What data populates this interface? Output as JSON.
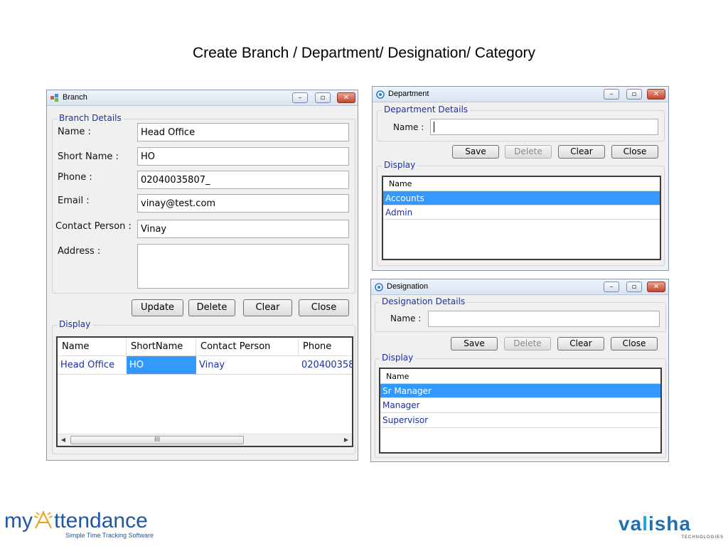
{
  "slide": {
    "title": "Create Branch / Department/ Designation/ Category"
  },
  "branch": {
    "window_title": "Branch",
    "group_details": "Branch Details",
    "fields": {
      "name": {
        "label": "Name :",
        "value": "Head Office"
      },
      "short_name": {
        "label": "Short Name :",
        "value": "HO"
      },
      "phone": {
        "label": "Phone :",
        "value": "02040035807_"
      },
      "email": {
        "label": "Email :",
        "value": "vinay@test.com"
      },
      "contact_person": {
        "label": "Contact Person :",
        "value": "Vinay"
      },
      "address": {
        "label": "Address :",
        "value": ""
      }
    },
    "buttons": {
      "update": "Update",
      "delete": "Delete",
      "clear": "Clear",
      "close": "Close"
    },
    "group_display": "Display",
    "columns": [
      "Name",
      "ShortName",
      "Contact Person",
      "Phone"
    ],
    "rows": [
      {
        "name": "Head Office",
        "short_name": "HO",
        "contact_person": "Vinay",
        "phone": "020400358"
      }
    ],
    "scroll_grip": "III"
  },
  "department": {
    "window_title": "Department",
    "group_details": "Department Details",
    "name_label": "Name :",
    "name_value": "",
    "buttons": {
      "save": "Save",
      "delete": "Delete",
      "clear": "Clear",
      "close": "Close"
    },
    "group_display": "Display",
    "column": "Name",
    "rows": [
      "Accounts",
      "Admin"
    ]
  },
  "designation": {
    "window_title": "Designation",
    "group_details": "Designation Details",
    "name_label": "Name :",
    "name_value": "",
    "buttons": {
      "save": "Save",
      "delete": "Delete",
      "clear": "Clear",
      "close": "Close"
    },
    "group_display": "Display",
    "column": "Name",
    "rows": [
      "Sr Manager",
      "Manager",
      "Supervisor"
    ]
  },
  "logos": {
    "left_word_prefix": "my",
    "left_word_suffix": "ttendance",
    "left_tagline": "Simple Time Tracking Software",
    "right_word_a": "va",
    "right_word_b": "l",
    "right_word_c": "isha",
    "right_tagline": "TECHNOLOGIES"
  },
  "colors": {
    "selection": "#3399ff",
    "link_text": "#1b2fa5",
    "logo_blue": "#1d57a8"
  }
}
